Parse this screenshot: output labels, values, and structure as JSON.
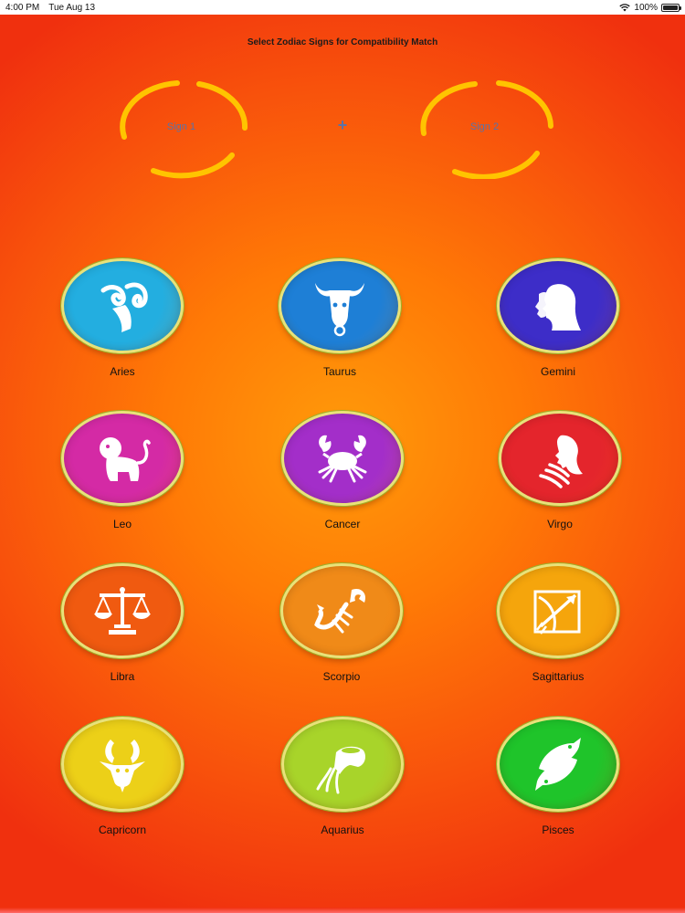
{
  "status_bar": {
    "time": "4:00 PM",
    "date": "Tue Aug 13",
    "battery_percent": "100%",
    "battery_level": 1.0
  },
  "header": {
    "title": "Select Zodiac Signs for Compatibility Match"
  },
  "selection": {
    "slot1_label": "Sign 1",
    "slot2_label": "Sign 2",
    "plus": "+"
  },
  "colors": {
    "ring": "#ffc400",
    "background_center": "#ff9a0a",
    "background_edge": "#f0300e"
  },
  "signs": [
    {
      "label": "Aries",
      "icon": "aries-icon",
      "color": "#23aee0"
    },
    {
      "label": "Taurus",
      "icon": "taurus-icon",
      "color": "#1e7fd6"
    },
    {
      "label": "Gemini",
      "icon": "gemini-icon",
      "color": "#3d2dc8"
    },
    {
      "label": "Leo",
      "icon": "leo-icon",
      "color": "#d42aa5"
    },
    {
      "label": "Cancer",
      "icon": "cancer-icon",
      "color": "#a32ec9"
    },
    {
      "label": "Virgo",
      "icon": "virgo-icon",
      "color": "#e4252c"
    },
    {
      "label": "Libra",
      "icon": "libra-icon",
      "color": "#f05a10"
    },
    {
      "label": "Scorpio",
      "icon": "scorpio-icon",
      "color": "#f08a18"
    },
    {
      "label": "Sagittarius",
      "icon": "sagittarius-icon",
      "color": "#f5a50c"
    },
    {
      "label": "Capricorn",
      "icon": "capricorn-icon",
      "color": "#ecd018"
    },
    {
      "label": "Aquarius",
      "icon": "aquarius-icon",
      "color": "#a8d42a"
    },
    {
      "label": "Pisces",
      "icon": "pisces-icon",
      "color": "#1fc42a"
    }
  ]
}
